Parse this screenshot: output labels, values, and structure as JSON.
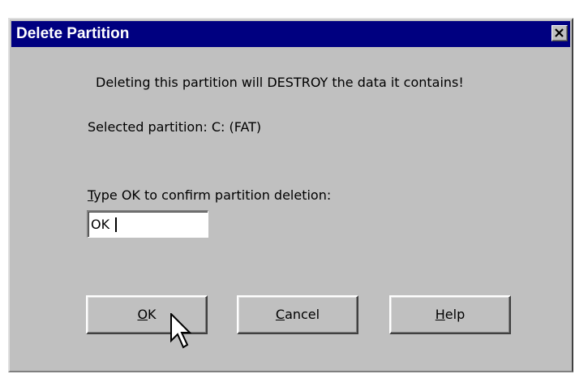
{
  "window": {
    "title": "Delete Partition",
    "colors": {
      "titlebar": "#000080",
      "face": "#c0c0c0",
      "title_text": "#ffffff"
    }
  },
  "message": {
    "warning": "Deleting this partition will DESTROY the data it contains!",
    "selected_partition": "Selected partition: C:  (FAT)"
  },
  "confirm": {
    "prompt_accel": "T",
    "prompt_rest": "ype OK to confirm partition deletion:",
    "input_value": "OK"
  },
  "buttons": {
    "ok_accel": "O",
    "ok_rest": "K",
    "cancel_accel": "C",
    "cancel_rest": "ancel",
    "help_accel": "H",
    "help_rest": "elp"
  },
  "icons": {
    "close": "close-icon",
    "pointer": "mouse-pointer-icon"
  }
}
